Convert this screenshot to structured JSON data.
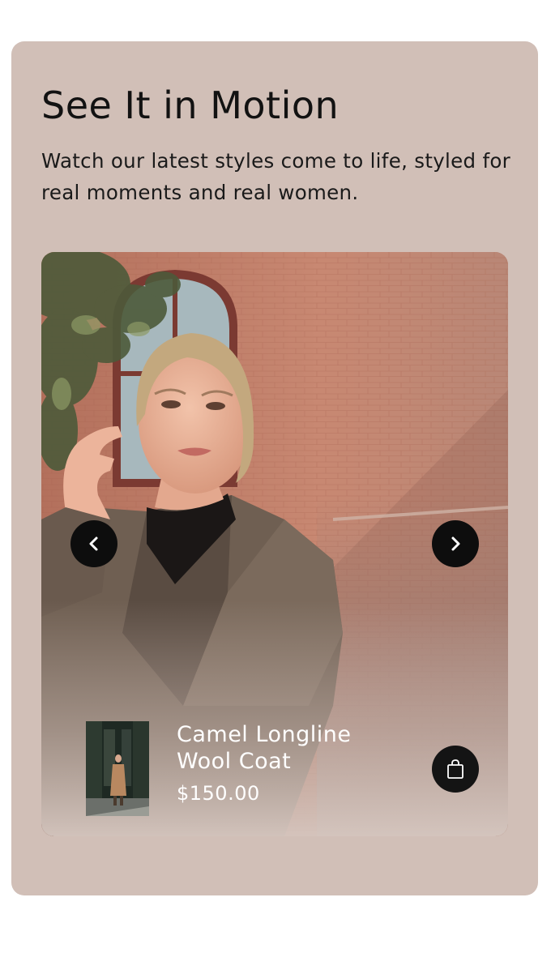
{
  "section": {
    "title": "See It in Motion",
    "subtitle": "Watch our latest styles come to life, styled for real moments and real women."
  },
  "carousel": {
    "prev_icon": "chevron-left-icon",
    "next_icon": "chevron-right-icon"
  },
  "product": {
    "name": "Camel Longline Wool Coat",
    "price": "$150.00",
    "bag_icon": "shopping-bag-icon"
  },
  "colors": {
    "card_background": "#d1bfb7",
    "button_background": "#0d0d0d",
    "text_dark": "#121212",
    "text_light": "#ffffff"
  }
}
